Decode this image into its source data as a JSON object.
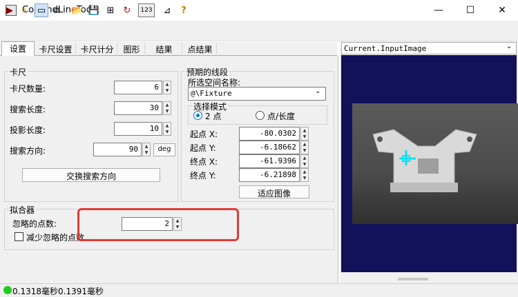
{
  "window": {
    "title": "CogFindLineTool1",
    "minimize": "—",
    "maximize": "☐",
    "close": "✕"
  },
  "toolbar": {
    "run": "▶",
    "electric": "⚡",
    "disp1": "▭",
    "disp2": "⧉",
    "open": "📂",
    "save": "💾",
    "t1": "⊞",
    "t2": "↻",
    "t3": "123",
    "t4": "⊿",
    "help": "?"
  },
  "tabs": [
    "设置",
    "卡尺设置",
    "卡尺计分",
    "图形",
    "结果",
    "点结果"
  ],
  "caliper": {
    "group_label": "卡尺",
    "count_label": "卡尺数量:",
    "count_value": "6",
    "search_len_label": "搜索长度:",
    "search_len_value": "30",
    "proj_len_label": "投影长度:",
    "proj_len_value": "10",
    "dir_label": "搜索方向:",
    "dir_value": "90",
    "dir_unit": "deg",
    "swap_button": "交换搜索方向"
  },
  "expected": {
    "group_label": "预期的线段",
    "space_label": "所选空间名称:",
    "space_value": "@\\Fixture",
    "mode_label": "选择模式",
    "mode_two_points": "2 点",
    "mode_point_length": "点/长度",
    "start_x_label": "起点 X:",
    "start_x_value": "-80.0302",
    "start_y_label": "起点 Y:",
    "start_y_value": "-6.18662",
    "end_x_label": "终点 X:",
    "end_x_value": "-61.9396",
    "end_y_label": "终点 Y:",
    "end_y_value": "-6.21898",
    "fit_button": "适应图像"
  },
  "fitter": {
    "group_label": "拟合器",
    "ignore_label": "忽略的点数:",
    "ignore_value": "2",
    "reduce_label": "减少忽略的点数"
  },
  "viewer": {
    "title": "Current.InputImage"
  },
  "status": {
    "text": "0.1318毫秒0.1391毫秒"
  },
  "colors": {
    "accent": "#0078d4",
    "highlight": "#e53935",
    "viewer_bg": "#12125a",
    "ok": "#22cc22"
  }
}
